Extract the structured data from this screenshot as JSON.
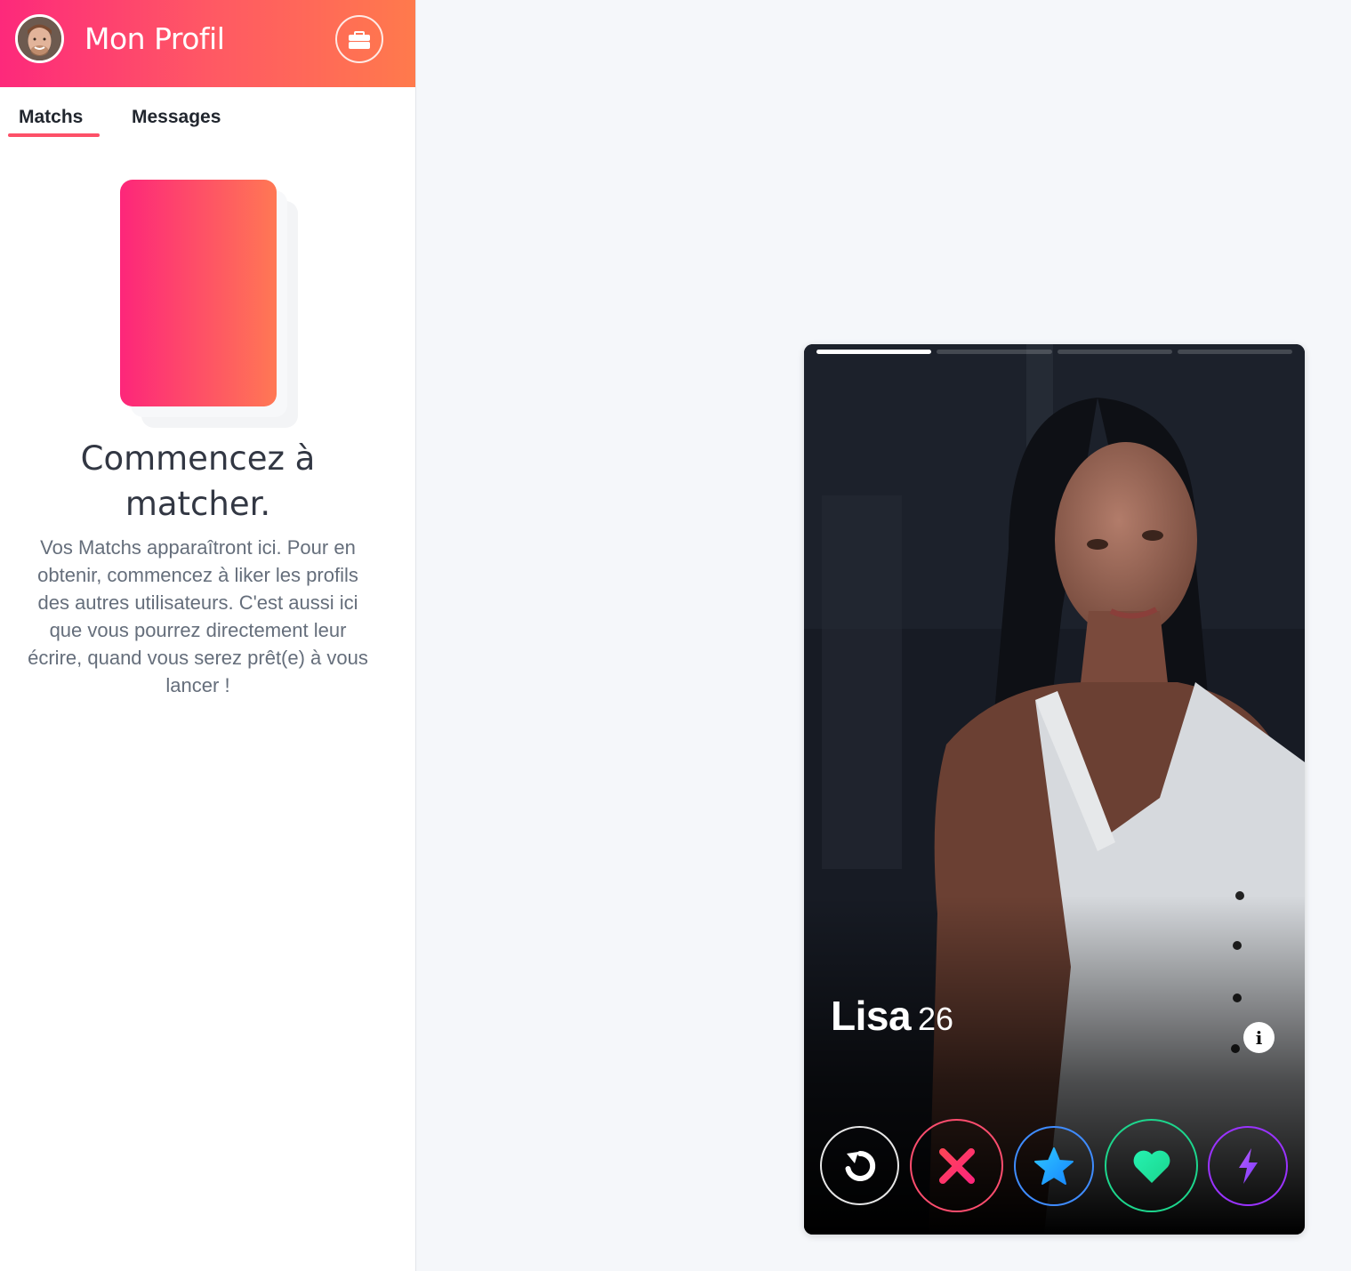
{
  "header": {
    "title": "Mon Profil"
  },
  "tabs": [
    {
      "label": "Matchs",
      "active": true
    },
    {
      "label": "Messages",
      "active": false
    }
  ],
  "empty_state": {
    "title": "Commencez à matcher.",
    "text": "Vos Matchs apparaîtront ici. Pour en obtenir, commencez à liker les profils des autres utilisateurs. C'est aussi ici que vous pourrez directement leur écrire, quand vous serez prêt(e) à vous lancer !"
  },
  "card": {
    "name": "Lisa",
    "age": "26",
    "photo_count": 4,
    "active_photo": 1,
    "info_label": "i"
  },
  "actions": [
    {
      "name": "rewind-button",
      "icon": "rewind-icon"
    },
    {
      "name": "nope-button",
      "icon": "close-icon"
    },
    {
      "name": "super-like-button",
      "icon": "star-icon"
    },
    {
      "name": "like-button",
      "icon": "heart-icon"
    },
    {
      "name": "boost-button",
      "icon": "lightning-icon"
    }
  ],
  "colors": {
    "brand_start": "#fd267a",
    "brand_end": "#ff7854",
    "tab_underline": "#fd5068",
    "background": "#f5f7fa"
  }
}
